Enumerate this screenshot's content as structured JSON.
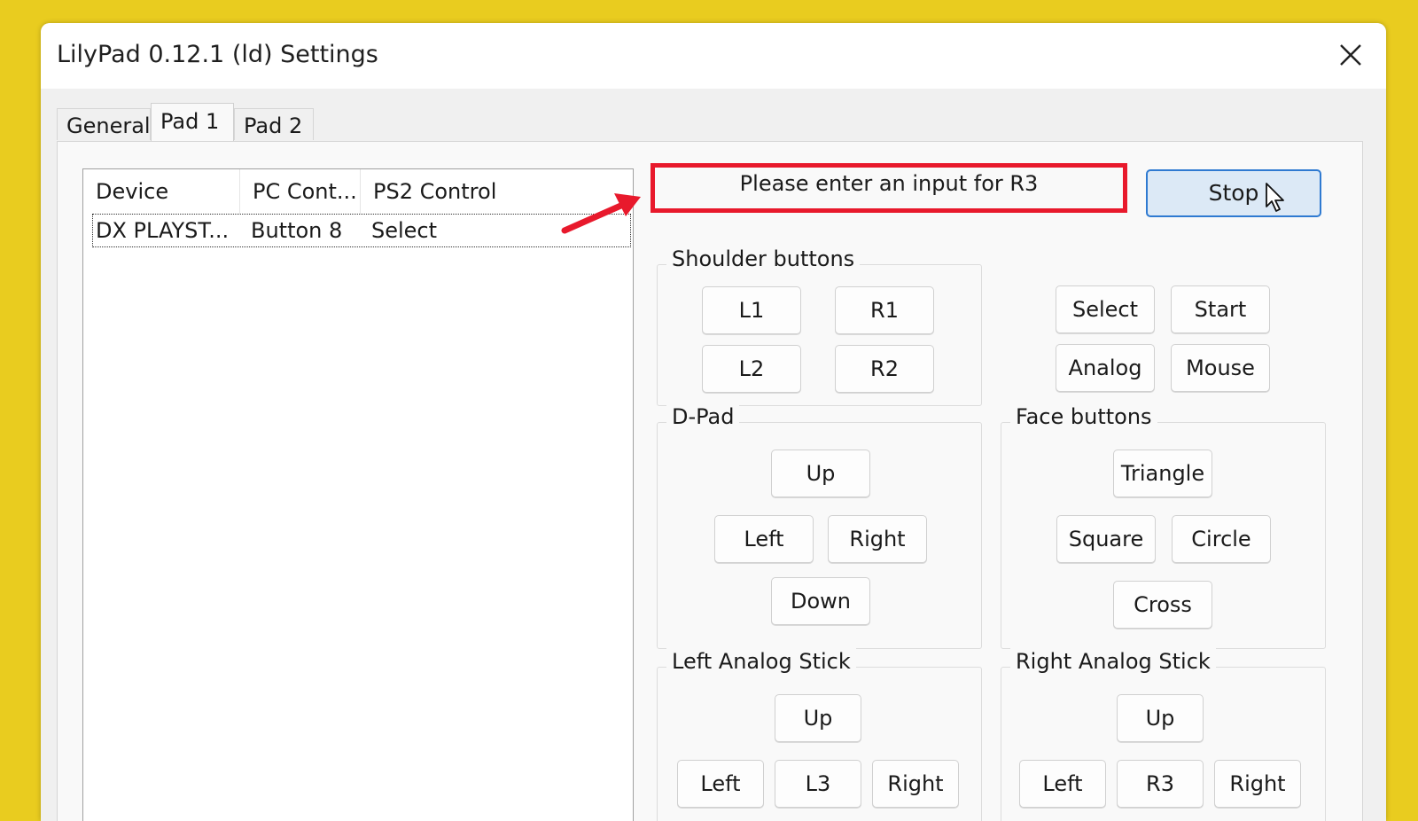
{
  "window": {
    "title": "LilyPad 0.12.1 (ld) Settings",
    "close_icon": "close-icon"
  },
  "tabs": [
    {
      "label": "General",
      "active": false
    },
    {
      "label": "Pad 1",
      "active": true
    },
    {
      "label": "Pad 2",
      "active": false
    }
  ],
  "bindings_list": {
    "columns": [
      "Device",
      "PC Cont...",
      "PS2 Control"
    ],
    "rows": [
      {
        "device": "DX PLAYST...",
        "pc_control": "Button 8",
        "ps2_control": "Select"
      }
    ]
  },
  "prompt": {
    "text": "Please enter an input for R3",
    "highlight_color": "#e8192c"
  },
  "stop_button": {
    "label": "Stop"
  },
  "groups": {
    "shoulder": {
      "label": "Shoulder buttons",
      "buttons": [
        "L1",
        "R1",
        "L2",
        "R2"
      ]
    },
    "misc": {
      "buttons": [
        "Select",
        "Start",
        "Analog",
        "Mouse"
      ]
    },
    "dpad": {
      "label": "D-Pad",
      "buttons": [
        "Up",
        "Left",
        "Right",
        "Down"
      ]
    },
    "face": {
      "label": "Face buttons",
      "buttons": [
        "Triangle",
        "Square",
        "Circle",
        "Cross"
      ]
    },
    "left_stick": {
      "label": "Left Analog Stick",
      "buttons": [
        "Up",
        "Left",
        "L3",
        "Right"
      ]
    },
    "right_stick": {
      "label": "Right Analog Stick",
      "buttons": [
        "Up",
        "Left",
        "R3",
        "Right"
      ]
    }
  },
  "annotation": {
    "arrow_color": "#e8192c"
  }
}
